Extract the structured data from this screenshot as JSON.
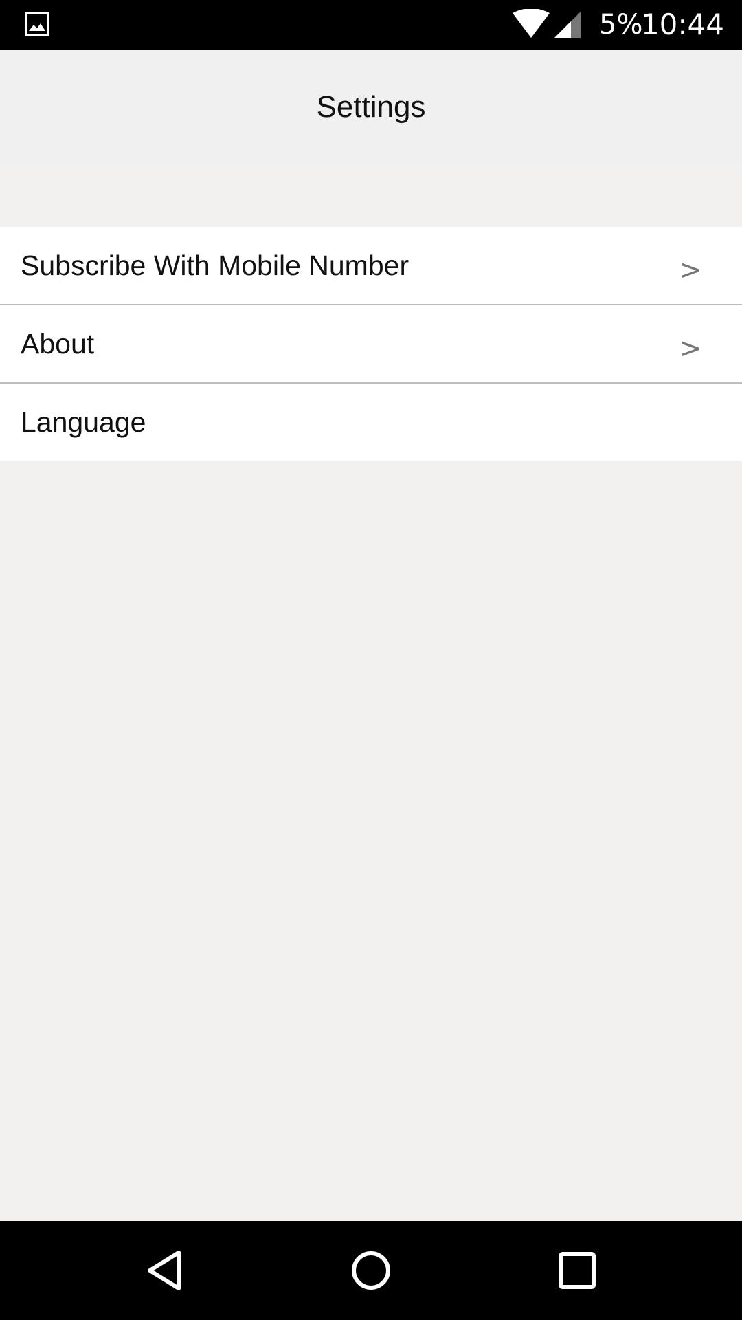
{
  "status_bar": {
    "battery_percent": "5%",
    "time": "10:44",
    "icons": [
      "gallery-icon",
      "wifi-icon",
      "cell-signal-icon"
    ]
  },
  "header": {
    "title": "Settings"
  },
  "settings": {
    "items": [
      {
        "label": "Subscribe With Mobile Number",
        "chevron": ">"
      },
      {
        "label": "About",
        "chevron": ">"
      },
      {
        "label": "Language"
      }
    ]
  },
  "nav_bar": {
    "icons": [
      "back-icon",
      "home-icon",
      "recents-icon"
    ]
  },
  "colors": {
    "background": "#f2f1f0",
    "header_background": "#f0f0f0",
    "row_background": "#ffffff",
    "divider": "#bdbdbd",
    "chevron": "#777777",
    "system_bars": "#000000"
  }
}
